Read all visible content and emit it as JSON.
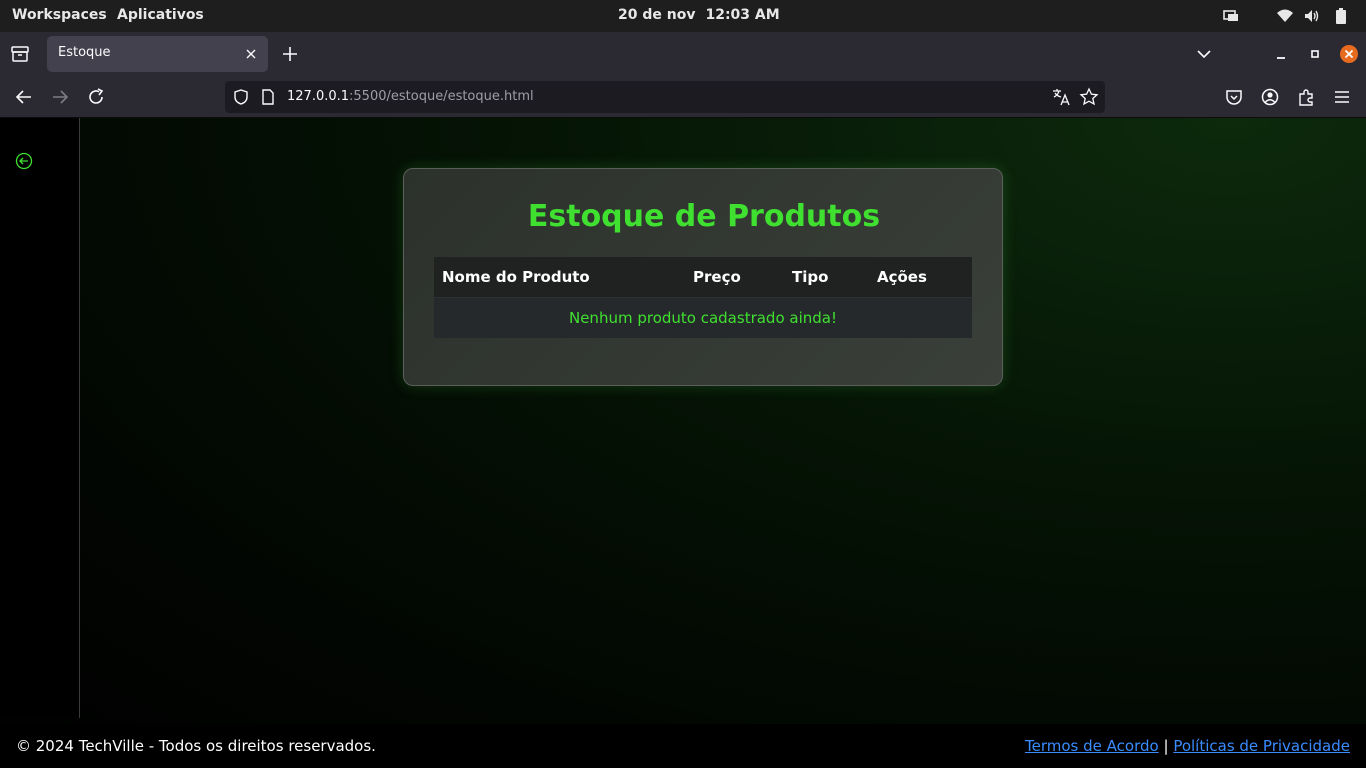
{
  "topbar": {
    "workspaces": "Workspaces",
    "applications": "Aplicativos",
    "date": "20 de nov",
    "time": "12:03 AM",
    "icons": [
      "display-icon",
      "wifi-icon",
      "volume-icon",
      "battery-icon"
    ]
  },
  "browser": {
    "tab_title": "Estoque",
    "url_host": "127.0.0.1",
    "url_rest": ":5500/estoque/estoque.html"
  },
  "page": {
    "title": "Estoque de Produtos",
    "columns": [
      "Nome do Produto",
      "Preço",
      "Tipo",
      "Ações"
    ],
    "empty_message": "Nenhum produto cadastrado ainda!",
    "footer": {
      "copyright": "© 2024 TechVille - Todos os direitos reservados.",
      "terms_link": "Termos de Acordo",
      "separator": "|",
      "privacy_link": "Políticas de Privacidade"
    }
  },
  "colors": {
    "accent_green": "#3fe030",
    "link_blue": "#3a8cff",
    "firefox_close": "#e66b1f"
  }
}
